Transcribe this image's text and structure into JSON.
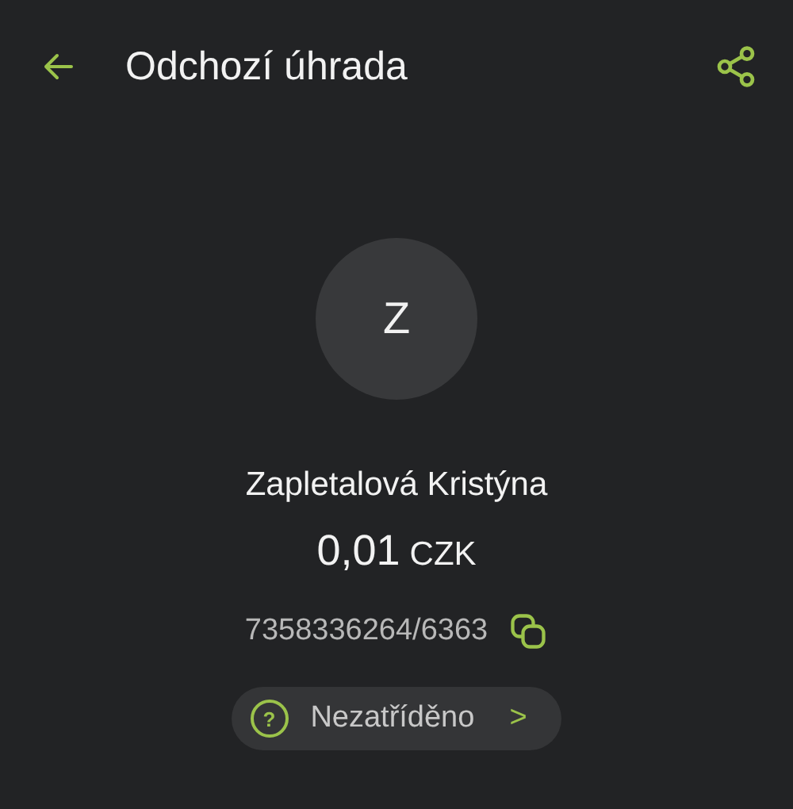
{
  "header": {
    "title": "Odchozí úhrada"
  },
  "avatar": {
    "initial": "Z"
  },
  "name": "Zapletalová Kristýna",
  "amount": {
    "value": "0,01",
    "currency": "CZK"
  },
  "account": "7358336264/6363",
  "category": {
    "label": "Nezatříděno",
    "icon": "?",
    "arrow": ">"
  }
}
